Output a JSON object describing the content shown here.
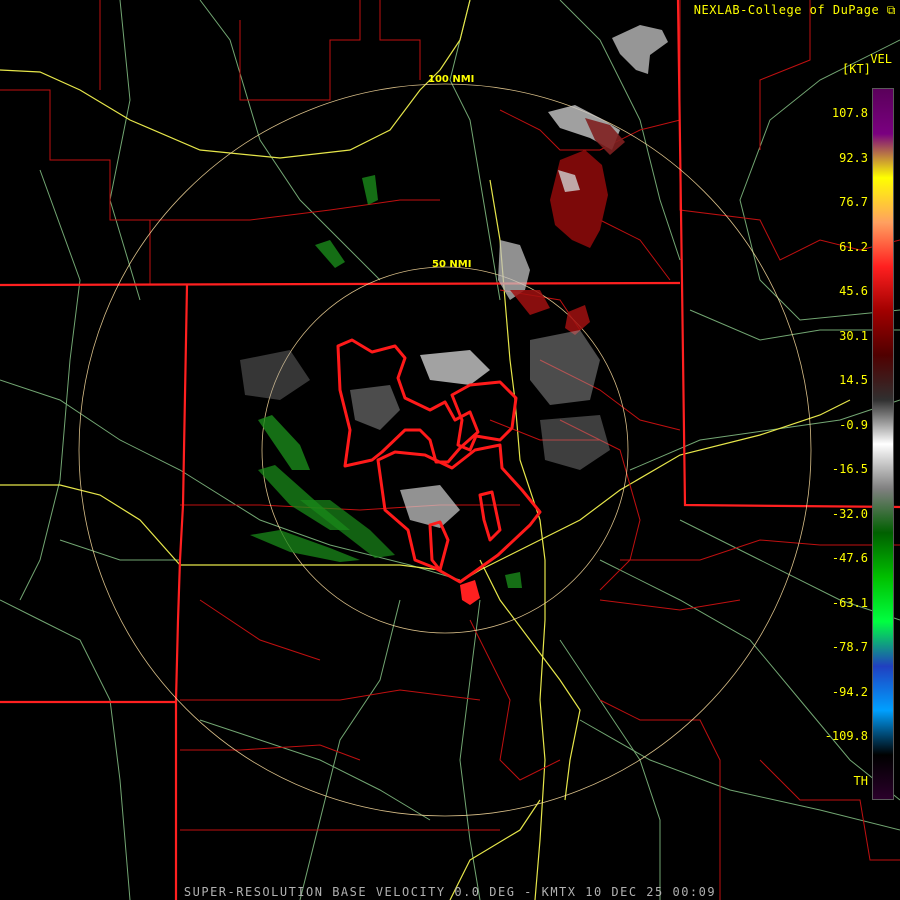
{
  "header": {
    "credit": "NEXLAB-College of DuPage"
  },
  "caption": "SUPER-RESOLUTION BASE VELOCITY 0.0 DEG - KMTX 10 DEC 25 00:09",
  "map": {
    "range_rings": [
      "100 NMI",
      "50 NMI"
    ],
    "colors": {
      "county_lines": "#c01010",
      "state_lines": "#ff2020",
      "highways": "#e6e64a",
      "roads": "#7fb87f",
      "range_rings": "#ffe0a0",
      "warning_polygons": "#ff1a1a"
    }
  },
  "legend": {
    "product": "VEL",
    "unit": "[KT]",
    "labels": [
      "107.8",
      "92.3",
      "76.7",
      "61.2",
      "45.6",
      "30.1",
      "14.5",
      "-0.9",
      "-16.5",
      "-32.0",
      "-47.6",
      "-63.1",
      "-78.7",
      "-94.2",
      "-109.8",
      "TH"
    ],
    "colors": [
      "#5a005a",
      "#7a0080",
      "#ffff00",
      "#ffa060",
      "#ff2020",
      "#a00000",
      "#500000",
      "#303030",
      "#ffffff",
      "#808080",
      "#006000",
      "#00c000",
      "#00ff40",
      "#2040c0",
      "#00a0ff",
      "#000000",
      "#2a002a"
    ]
  }
}
